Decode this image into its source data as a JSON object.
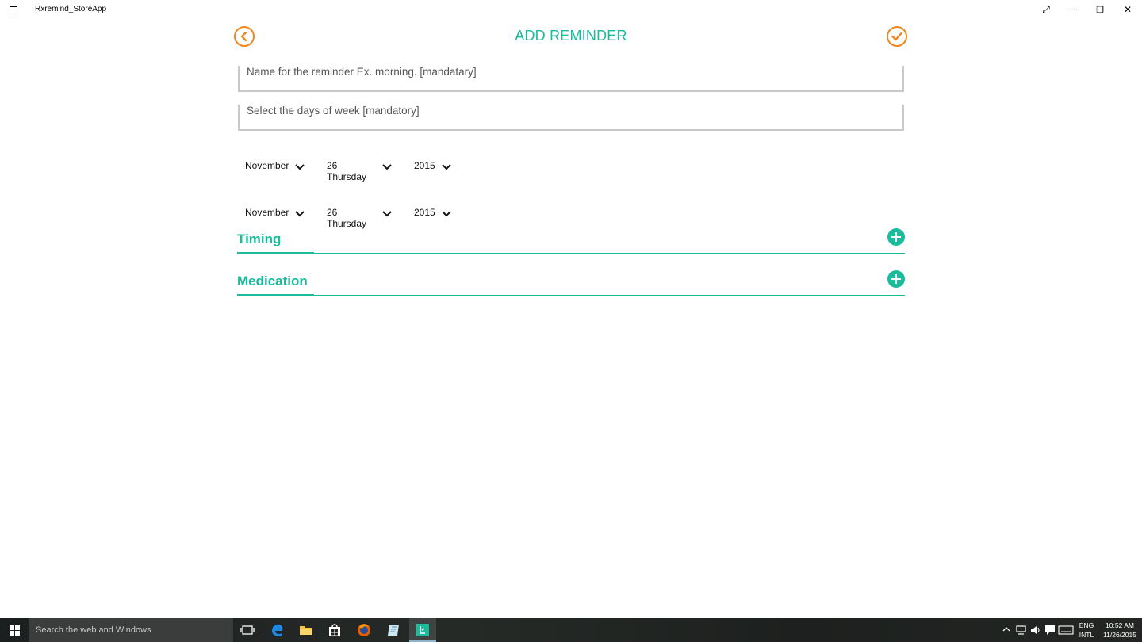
{
  "window": {
    "app_title": "Rxremind_StoreApp",
    "controls": {
      "expand": "⤢",
      "minimize": "—",
      "restore": "❐",
      "close": "✕"
    }
  },
  "header": {
    "title": "ADD REMINDER",
    "back_icon": "back-arrow-icon",
    "save_icon": "checkmark-icon"
  },
  "form": {
    "name_placeholder": "Name for the reminder Ex. morning. [mandatary]",
    "days_placeholder": "Select the days of week [mandatory]",
    "start_date": {
      "month": "November",
      "day": "26 Thursday",
      "year": "2015"
    },
    "end_date": {
      "month": "November",
      "day": "26 Thursday",
      "year": "2015"
    }
  },
  "sections": [
    {
      "label": "Timing"
    },
    {
      "label": "Medication"
    }
  ],
  "taskbar": {
    "search_placeholder": "Search the web and Windows",
    "language_line1": "ENG",
    "language_line2": "INTL",
    "time": "10:52 AM",
    "date": "11/26/2015"
  },
  "colors": {
    "accent": "#1abc9c",
    "orange": "#f0871b"
  }
}
